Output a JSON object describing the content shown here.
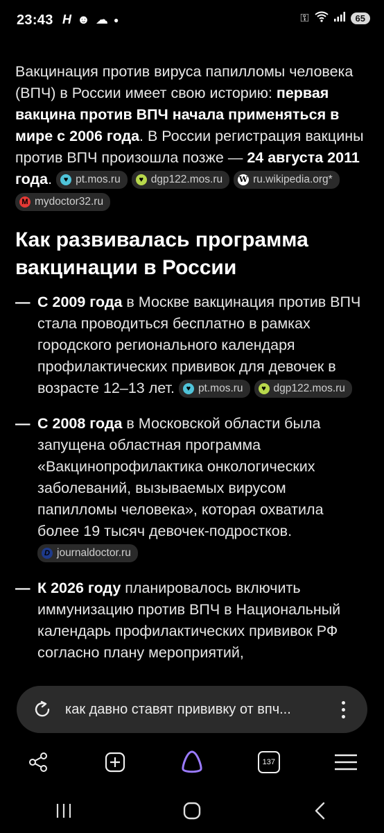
{
  "status": {
    "time": "23:43",
    "battery": "65"
  },
  "article": {
    "intro_part1": "Вакцинация против вируса папилломы человека (ВПЧ) в России имеет свою историю: ",
    "intro_bold1": "первая вакцина против ВПЧ начала применяться в мире с 2006 года",
    "intro_part2": ". В России регистрация вакцины против ВПЧ произошла позже — ",
    "intro_bold2": "24 августа 2011 года",
    "intro_part3": ".",
    "intro_sources": [
      "pt.mos.ru",
      "dgp122.mos.ru",
      "ru.wikipedia.org*",
      "mydoctor32.ru"
    ],
    "heading": "Как развивалась программа вакцинации в России",
    "items": [
      {
        "dash": "—",
        "bold": "С 2009 года",
        "text": " в Москве вакцинация против ВПЧ стала проводиться бесплатно в рамках городского регионального календаря профилактических прививок для девочек в возрасте 12–13 лет.",
        "sources": [
          "pt.mos.ru",
          "dgp122.mos.ru"
        ]
      },
      {
        "dash": "—",
        "bold": "С 2008 года",
        "text": " в Московской области была запущена областная программа «Вакцинопрофилактика онкологических заболеваний, вызываемых вирусом папилломы человека», которая охватила более 19 тысяч девочек-подростков.",
        "sources": [
          "journaldoctor.ru"
        ]
      },
      {
        "dash": "—",
        "bold": "К 2026 году",
        "text": " планировалось включить иммунизацию против ВПЧ в Национальный календарь профилактических прививок РФ согласно плану мероприятий,",
        "sources": []
      }
    ]
  },
  "query": {
    "text": "как давно ставят прививку от впч..."
  },
  "toolbar": {
    "tabs_count": "137"
  },
  "icons": {
    "share": "share-icon",
    "new_tab": "plus-square-icon",
    "assistant": "alice-icon",
    "tabs": "tabs-icon",
    "menu": "menu-icon",
    "reload": "reload-icon",
    "more": "more-vertical-icon"
  },
  "colors": {
    "background": "#000000",
    "pill": "#2b2b2b",
    "accent": "#9b7bff"
  }
}
